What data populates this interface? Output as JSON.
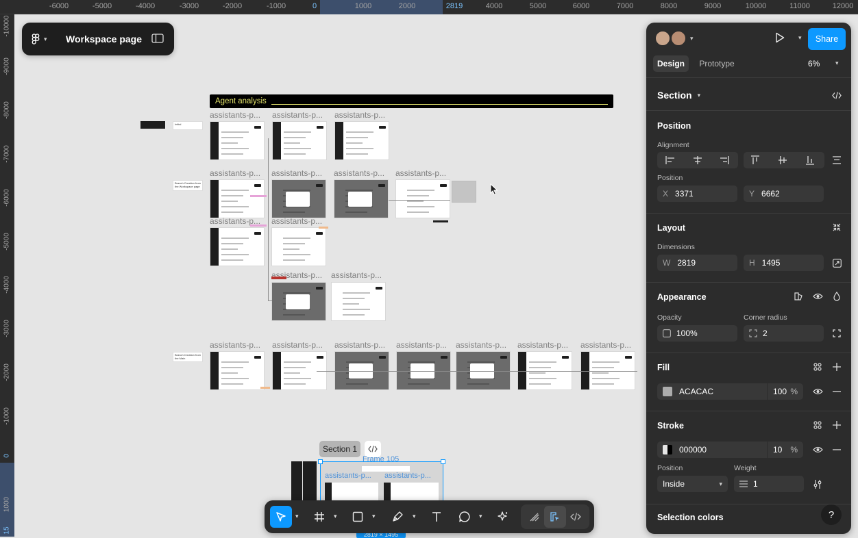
{
  "rulers": {
    "top_ticks": [
      "-6000",
      "-5000",
      "-4000",
      "-3000",
      "-2000",
      "-1000",
      "0",
      "1000",
      "2000",
      "2819",
      "4000",
      "5000",
      "6000",
      "7000",
      "8000",
      "9000",
      "10000",
      "11000",
      "12000"
    ],
    "left_ticks": [
      "-10000",
      "-9000",
      "-8000",
      "-7000",
      "-6000",
      "-5000",
      "-4000",
      "-3000",
      "-2000",
      "-1000",
      "0",
      "1000",
      "15"
    ]
  },
  "topbar": {
    "file_name": "Workspace page"
  },
  "canvas": {
    "agent_title": "Agent analysis",
    "frame_label": "assistants-p...",
    "badge_initial": "Initial",
    "badge_branch_workspace": "Branch Creation from the Workspace page",
    "badge_branch_main": "Branch Creation from the Main",
    "section_label": "Section 1",
    "frame105_label": "Frame 105",
    "selection_size": "2819 × 1495"
  },
  "panel": {
    "tabs": [
      "Design",
      "Prototype"
    ],
    "zoom": "6%",
    "share_label": "Share",
    "selection_type": "Section",
    "position_title": "Position",
    "alignment_label": "Alignment",
    "position_label": "Position",
    "x": {
      "label": "X",
      "value": "3371"
    },
    "y": {
      "label": "Y",
      "value": "6662"
    },
    "layout_title": "Layout",
    "dimensions_label": "Dimensions",
    "w": {
      "label": "W",
      "value": "2819"
    },
    "h": {
      "label": "H",
      "value": "1495"
    },
    "appearance_title": "Appearance",
    "opacity_label": "Opacity",
    "opacity_value": "100%",
    "corner_label": "Corner radius",
    "corner_value": "2",
    "fill_title": "Fill",
    "fill_hex": "ACACAC",
    "fill_opacity": "100",
    "pct": "%",
    "stroke_title": "Stroke",
    "stroke_hex": "000000",
    "stroke_opacity": "10",
    "stroke_position_label": "Position",
    "stroke_weight_label": "Weight",
    "stroke_position_value": "Inside",
    "stroke_weight_value": "1",
    "selection_colors_title": "Selection colors",
    "help": "?"
  },
  "colors": {
    "accent": "#0d99ff",
    "fill_swatch": "#acacac",
    "stroke_swatch": "#000000",
    "agent_bar": "#000000",
    "agent_title_text": "#e3e36b"
  }
}
